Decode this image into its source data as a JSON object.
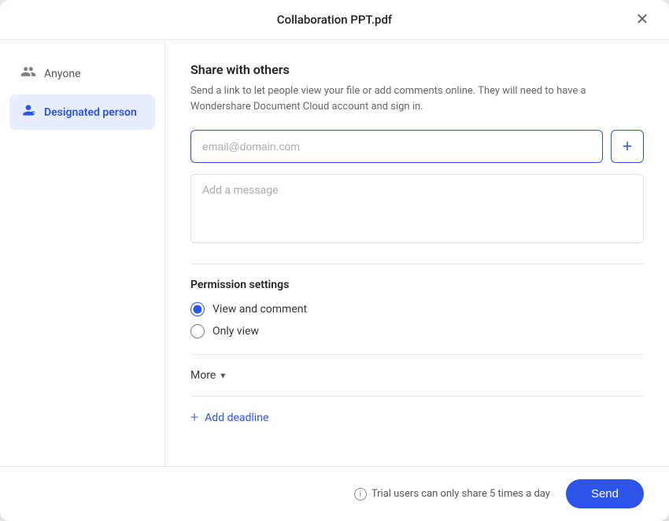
{
  "modal": {
    "title": "Collaboration PPT.pdf",
    "close_label": "×"
  },
  "sidebar": {
    "items": [
      {
        "id": "anyone",
        "label": "Anyone",
        "icon": "people-icon",
        "active": false
      },
      {
        "id": "designated-person",
        "label": "Designated person",
        "icon": "person-badge-icon",
        "active": true
      }
    ]
  },
  "content": {
    "share_title": "Share with others",
    "share_desc": "Send a link to let people view your file or add comments online. They will need to have a Wondershare Document Cloud account and sign in.",
    "email_placeholder": "email@domain.com",
    "add_button_label": "+",
    "message_placeholder": "Add a message",
    "permission_title": "Permission settings",
    "permissions": [
      {
        "id": "view-and-comment",
        "label": "View and comment",
        "checked": true
      },
      {
        "id": "only-view",
        "label": "Only view",
        "checked": false
      }
    ],
    "more_label": "More",
    "add_deadline_label": "Add deadline"
  },
  "footer": {
    "trial_notice": "Trial users can only share 5 times a day",
    "send_label": "Send"
  }
}
